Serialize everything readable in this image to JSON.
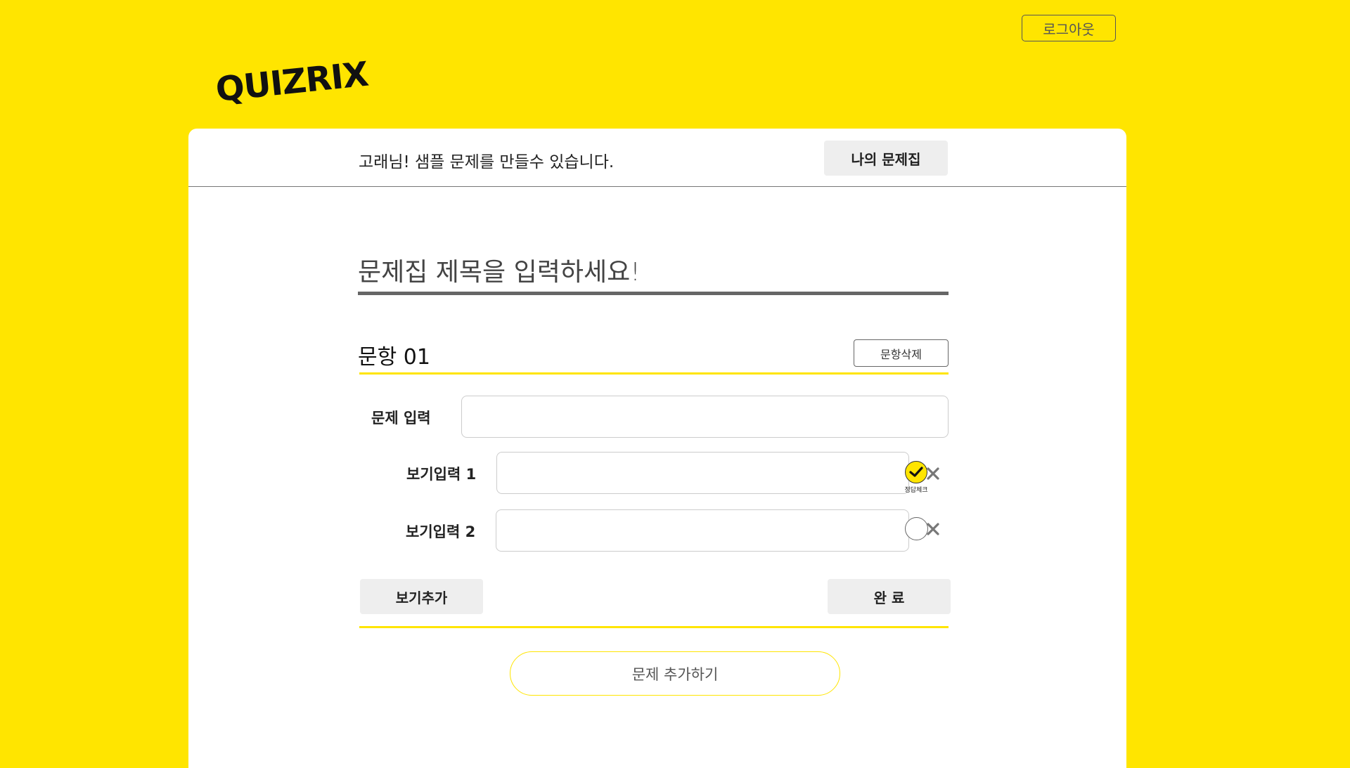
{
  "header": {
    "logout_label": "로그아웃",
    "logo_text": "QUIZRIX"
  },
  "card": {
    "greeting": "고래님! 샘플 문제를 만들수 있습니다.",
    "my_book_label": "나의 문제집",
    "title_placeholder": "문제집 제목을 입력하세요!",
    "question": {
      "title": "문항 01",
      "delete_label": "문항삭제",
      "question_label": "문제 입력",
      "question_value": "",
      "choices": [
        {
          "label": "보기입력 1",
          "value": "",
          "is_answer": true,
          "answer_caption": "정답체크"
        },
        {
          "label": "보기입력 2",
          "value": "",
          "is_answer": false
        }
      ],
      "add_choice_label": "보기추가",
      "done_label": "완 료"
    },
    "add_question_label": "문제 추가하기"
  },
  "colors": {
    "accent": "#FFE500",
    "button_grey": "#EEEEEE"
  },
  "icons": {
    "answer_check": "check-circle-icon",
    "empty_answer": "empty-circle-icon",
    "remove_choice": "close-icon"
  }
}
